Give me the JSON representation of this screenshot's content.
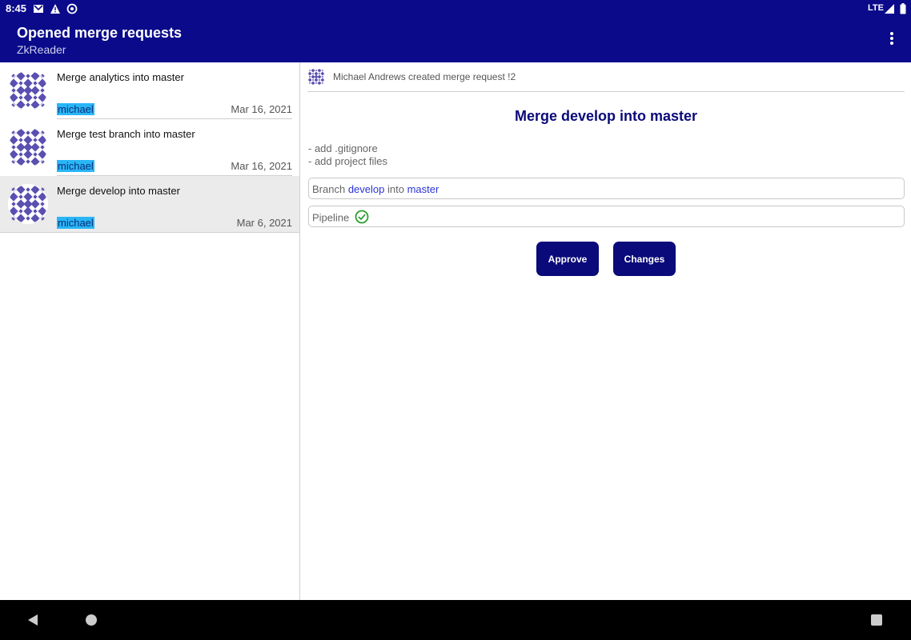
{
  "status_bar": {
    "time": "8:45",
    "network": "LTE",
    "icons": [
      "gmail-icon",
      "warning-icon",
      "sync-icon",
      "signal-icon",
      "battery-icon"
    ]
  },
  "app_bar": {
    "title": "Opened merge requests",
    "subtitle": "ZkReader",
    "menu_icon": "more-vert-icon"
  },
  "merge_requests": [
    {
      "title": "Merge analytics into master",
      "author": "michael",
      "date": "Mar 16, 2021",
      "selected": false
    },
    {
      "title": "Merge test branch into master",
      "author": "michael",
      "date": "Mar 16, 2021",
      "selected": false
    },
    {
      "title": "Merge develop into master",
      "author": "michael",
      "date": "Mar 6, 2021",
      "selected": true
    }
  ],
  "detail": {
    "created_text": "Michael Andrews created merge request !2",
    "title": "Merge develop into master",
    "description_lines": [
      "- add .gitignore",
      "- add project files"
    ],
    "branch": {
      "prefix": "Branch",
      "source": "develop",
      "into": "into",
      "target": "master"
    },
    "pipeline": {
      "label": "Pipeline",
      "status_icon": "check-circle-icon"
    },
    "approve_label": "Approve",
    "changes_label": "Changes"
  },
  "colors": {
    "primary": "#0a0a8a",
    "author_highlight": "#29b6f6",
    "link": "#2a34d6",
    "success": "#2e9e2e",
    "avatar": "#5a50b0"
  }
}
